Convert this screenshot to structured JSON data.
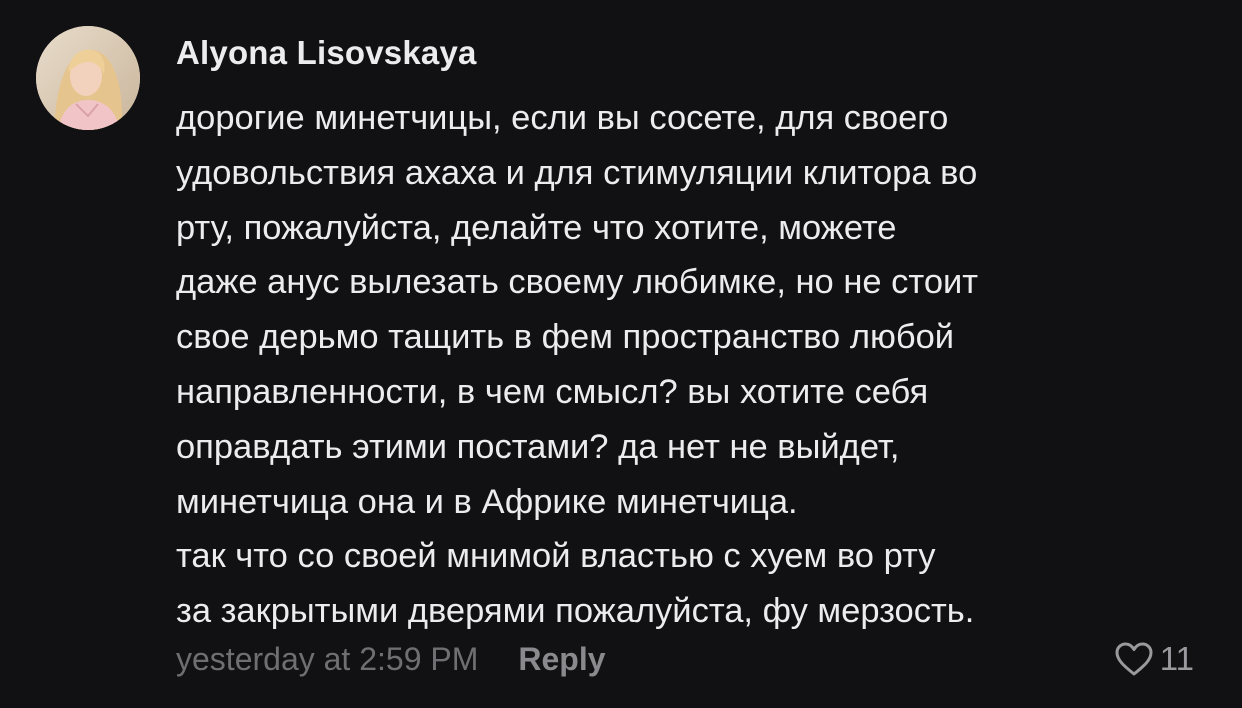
{
  "comment": {
    "author": "Alyona Lisovskaya",
    "lines": [
      "дорогие минетчицы, если вы сосете, для своего",
      "удовольствия ахаха и для стимуляции клитора во",
      "рту, пожалуйста, делайте что хотите, можете",
      "даже анус вылезать своему любимке, но не стоит",
      "свое дерьмо тащить в фем пространство любой",
      "направленности, в чем смысл? вы хотите себя",
      "оправдать этими постами? да нет не выйдет,",
      "минетчица она и в Африке минетчица.",
      "так что со своей мнимой властью с хуем во рту",
      "за закрытыми дверями пожалуйста, фу мерзость."
    ],
    "timestamp": "yesterday at 2:59 PM",
    "reply_label": "Reply",
    "like_count": "11",
    "icons": {
      "avatar": "user-avatar-photo",
      "like": "heart-outline-icon"
    },
    "colors": {
      "background": "#111113",
      "text": "#ececee",
      "meta": "#6f6f73"
    }
  }
}
